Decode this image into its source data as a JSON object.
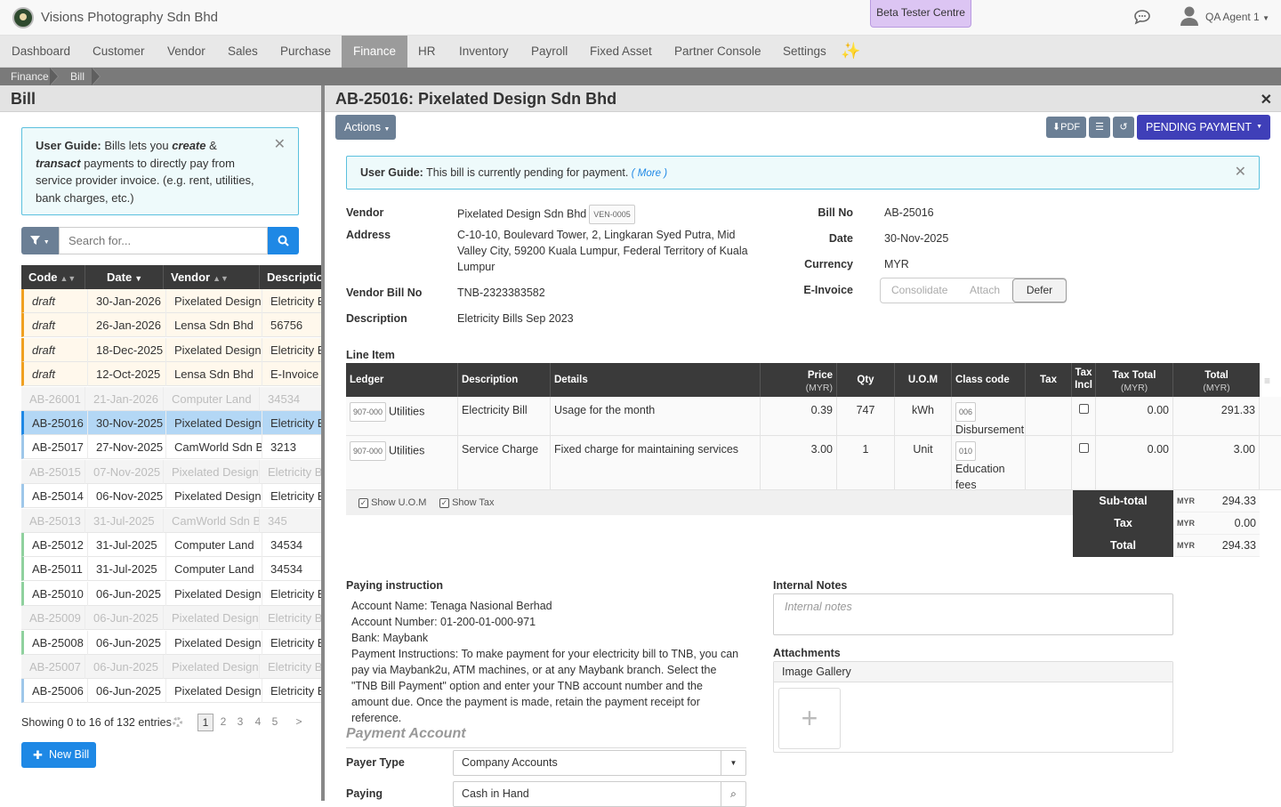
{
  "header": {
    "company": "Visions Photography Sdn Bhd",
    "beta": "Beta Tester Centre",
    "user": "QA Agent 1"
  },
  "nav": {
    "items": [
      "Dashboard",
      "Customer",
      "Vendor",
      "Sales",
      "Purchase",
      "Finance",
      "HR",
      "Inventory",
      "Payroll",
      "Fixed Asset",
      "Partner Console",
      "Settings"
    ],
    "active": "Finance"
  },
  "breadcrumb": [
    "Finance",
    "Bill"
  ],
  "left": {
    "title": "Bill",
    "guide_prefix": "User Guide:",
    "guide_1": "Bills lets you",
    "guide_create": "create",
    "guide_amp": "&",
    "guide_transact": "transact",
    "guide_2": "payments to directly pay from service provider invoice. (e.g. rent, utilities, bank charges, etc.)",
    "search_placeholder": "Search for...",
    "columns": [
      "Code",
      "Date",
      "Vendor",
      "Description"
    ],
    "rows": [
      {
        "code": "draft",
        "date": "30-Jan-2026",
        "vendor": "Pixelated Design Sdn Bhd",
        "desc": "Eletricity Bills"
      },
      {
        "code": "draft",
        "date": "26-Jan-2026",
        "vendor": "Lensa Sdn Bhd",
        "desc": "56756"
      },
      {
        "code": "draft",
        "date": "18-Dec-2025",
        "vendor": "Pixelated Design Sdn Bhd",
        "desc": "Eletricity Bills"
      },
      {
        "code": "draft",
        "date": "12-Oct-2025",
        "vendor": "Lensa Sdn Bhd",
        "desc": "E-Invoice bill"
      },
      {
        "code": "AB-26001",
        "date": "21-Jan-2026",
        "vendor": "Computer Land",
        "desc": "34534"
      },
      {
        "code": "AB-25016",
        "date": "30-Nov-2025",
        "vendor": "Pixelated Design Sdn Bhd",
        "desc": "Eletricity Bills"
      },
      {
        "code": "AB-25017",
        "date": "27-Nov-2025",
        "vendor": "CamWorld Sdn Bhd",
        "desc": "3213"
      },
      {
        "code": "AB-25015",
        "date": "07-Nov-2025",
        "vendor": "Pixelated Design Sdn Bhd",
        "desc": "Eletricity Bills"
      },
      {
        "code": "AB-25014",
        "date": "06-Nov-2025",
        "vendor": "Pixelated Design Sdn Bhd",
        "desc": "Eletricity Bills"
      },
      {
        "code": "AB-25013",
        "date": "31-Jul-2025",
        "vendor": "CamWorld Sdn Bhd",
        "desc": "345"
      },
      {
        "code": "AB-25012",
        "date": "31-Jul-2025",
        "vendor": "Computer Land",
        "desc": "34534"
      },
      {
        "code": "AB-25011",
        "date": "31-Jul-2025",
        "vendor": "Computer Land",
        "desc": "34534"
      },
      {
        "code": "AB-25010",
        "date": "06-Jun-2025",
        "vendor": "Pixelated Design Sdn Bhd",
        "desc": "Eletricity Bills"
      },
      {
        "code": "AB-25009",
        "date": "06-Jun-2025",
        "vendor": "Pixelated Design Sdn Bhd",
        "desc": "Eletricity Bills"
      },
      {
        "code": "AB-25008",
        "date": "06-Jun-2025",
        "vendor": "Pixelated Design Sdn Bhd",
        "desc": "Eletricity Bills"
      },
      {
        "code": "AB-25007",
        "date": "06-Jun-2025",
        "vendor": "Pixelated Design Sdn Bhd",
        "desc": "Eletricity Bills"
      },
      {
        "code": "AB-25006",
        "date": "06-Jun-2025",
        "vendor": "Pixelated Design Sdn Bhd",
        "desc": "Eletricity Bills"
      }
    ],
    "showing": "Showing 0 to 16 of 132 entries",
    "pages": [
      "1",
      "2",
      "3",
      "4",
      "5",
      ">"
    ],
    "new_bill": "New Bill"
  },
  "detail": {
    "title": "AB-25016: Pixelated Design Sdn Bhd",
    "actions": "Actions",
    "pdf": "PDF",
    "status": "PENDING PAYMENT",
    "guide_prefix": "User Guide:",
    "guide_text": "This bill is currently pending for payment.",
    "guide_more": "( More )",
    "labels": {
      "vendor": "Vendor",
      "address": "Address",
      "vendor_bill_no": "Vendor Bill No",
      "description": "Description",
      "bill_no": "Bill No",
      "date": "Date",
      "currency": "Currency",
      "einvoice": "E-Invoice"
    },
    "vendor": "Pixelated Design Sdn Bhd",
    "vendor_code": "VEN-0005",
    "address": "C-10-10, Boulevard Tower, 2, Lingkaran Syed Putra, Mid Valley City, 59200 Kuala Lumpur, Federal Territory of Kuala Lumpur",
    "vendor_bill_no": "TNB-2323383582",
    "description": "Eletricity Bills Sep 2023",
    "bill_no": "AB-25016",
    "date": "30-Nov-2025",
    "currency": "MYR",
    "einvoice_options": [
      "Consolidate",
      "Attach",
      "Defer"
    ],
    "line_item_title": "Line Item",
    "li_headers": {
      "ledger": "Ledger",
      "description": "Description",
      "details": "Details",
      "price": "Price",
      "qty": "Qty",
      "uom": "U.O.M",
      "class": "Class code",
      "tax": "Tax",
      "tax_incl_1": "Tax",
      "tax_incl_2": "Incl",
      "tax_total": "Tax Total",
      "total": "Total",
      "myr": "(MYR)"
    },
    "lines": [
      {
        "ledger_code": "907-000",
        "ledger": "Utilities",
        "description": "Electricity Bill",
        "details": "Usage for the month",
        "price": "0.39",
        "qty": "747",
        "uom": "kWh",
        "class_code": "006",
        "class_name": "Disbursement",
        "tax_total": "0.00",
        "total": "291.33"
      },
      {
        "ledger_code": "907-000",
        "ledger": "Utilities",
        "description": "Service Charge",
        "details": "Fixed charge for maintaining services",
        "price": "3.00",
        "qty": "1",
        "uom": "Unit",
        "class_code": "010",
        "class_name": "Education fees",
        "tax_total": "0.00",
        "total": "3.00"
      }
    ],
    "show_uom": "Show U.O.M",
    "show_tax": "Show Tax",
    "totals": {
      "subtotal_label": "Sub-total",
      "tax_label": "Tax",
      "total_label": "Total",
      "cur": "MYR",
      "subtotal": "294.33",
      "tax": "0.00",
      "total": "294.33"
    },
    "paying_instruction_label": "Paying instruction",
    "instr_lines": [
      "Account Name: Tenaga Nasional Berhad",
      "Account Number: 01-200-01-000-971",
      "Bank: Maybank",
      "Payment Instructions: To make payment for your electricity bill to TNB, you can pay via Maybank2u, ATM machines, or at any Maybank branch. Select the \"TNB Bill Payment\" option and enter your TNB account number and the amount due. Once the payment is made, retain the payment receipt for reference."
    ],
    "internal_notes_label": "Internal Notes",
    "internal_notes_placeholder": "Internal notes",
    "attachments_label": "Attachments",
    "gallery": "Image Gallery",
    "payment_account": "Payment Account",
    "payer_type_label": "Payer Type",
    "payer_type": "Company Accounts",
    "paying_label": "Paying",
    "paying": "Cash in Hand"
  }
}
